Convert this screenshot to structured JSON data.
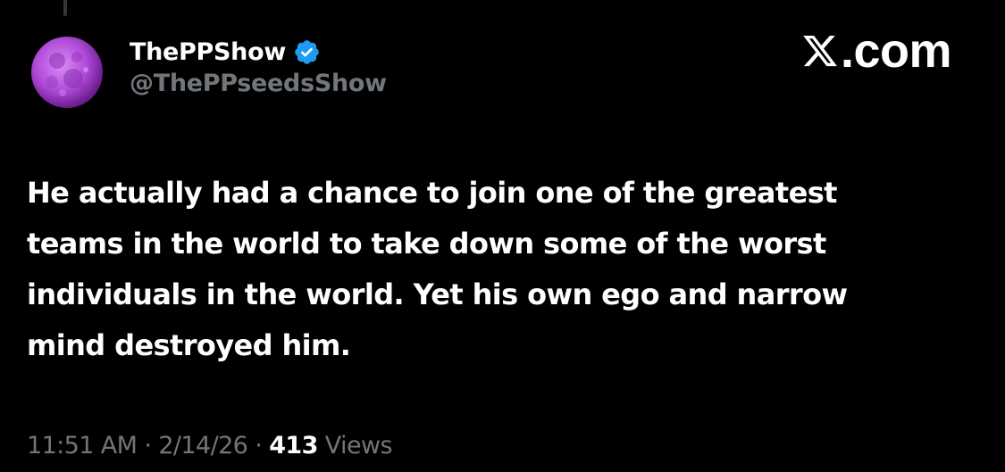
{
  "tweet": {
    "display_name": "ThePPShow",
    "handle": "@ThePPseedsShow",
    "verified_icon": "verified-badge-icon",
    "text": "He actually had a chance to join one of the greatest\nteams in the world to take down some of the worst\nindividuals in the world. Yet his own ego and narrow\nmind destroyed him.",
    "time": "11:51 AM",
    "date": "2/14/26",
    "separator": "·",
    "views_count": "413",
    "views_label": "Views"
  },
  "brand": {
    "text": ".com",
    "logo_icon": "x-logo-icon"
  },
  "colors": {
    "background": "#000000",
    "text_primary": "#ffffff",
    "text_secondary": "#71767b",
    "verified_blue": "#1d9bf0",
    "avatar_purple": "#b04ad8"
  }
}
